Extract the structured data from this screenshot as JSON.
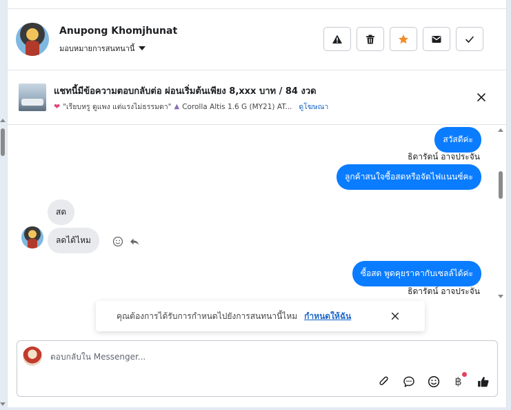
{
  "header": {
    "contact_name": "Anupong Khomjhunat",
    "assign_label": "มอบหมายการสนทนานี้",
    "actions": [
      {
        "icon": "warning-icon",
        "label": "report"
      },
      {
        "icon": "trash-icon",
        "label": "delete"
      },
      {
        "icon": "star-icon",
        "label": "star"
      },
      {
        "icon": "mail-icon",
        "label": "mark-unread"
      },
      {
        "icon": "check-icon",
        "label": "done"
      }
    ],
    "star_color": "#f28c28"
  },
  "ad": {
    "title": "แชทนี้มีข้อความตอบกลับต่อ ผ่อนเริ่มต้นเพียง 8,xxx บาท / 84 งวด",
    "subtitle_part1": "\"เรียบหรู ดูแพง แต่แรงไม่ธรรมดา\"",
    "subtitle_part2": "Corolla Altis 1.6 G (MY21) AT...",
    "link_label": "ดูโฆษณา"
  },
  "messages": {
    "out_1": "สวัสดีค่ะ",
    "sender_1": "ธิดารัตน์ อาจประจัน",
    "out_2": "ลูกค้าสนใจซื้อสดหรือจัดไฟแนนซ์คะ",
    "in_1": "สด",
    "in_2": "ลดได้ไหม",
    "out_3": "ซื้อสด พูดคุยราคากับเซลล์ได้ค่ะ",
    "sender_2": "ธิดารัตน์ อาจประจัน"
  },
  "toast": {
    "text": "คุณต้องการได้รับการกำหนดไปยังการสนทนานี้ไหม",
    "link": "กำหนดให้ฉัน"
  },
  "composer": {
    "placeholder": "ตอบกลับใน Messenger...",
    "tools": [
      "paperclip-icon",
      "chat-bubble-icon",
      "emoji-icon",
      "baht-icon",
      "thumbs-up-icon"
    ],
    "baht_symbol": "฿"
  },
  "colors": {
    "outgoing_bubble": "#0a7cff",
    "incoming_bubble": "#e9eaed",
    "link": "#1a66c8",
    "notification_dot": "#e4405f"
  }
}
